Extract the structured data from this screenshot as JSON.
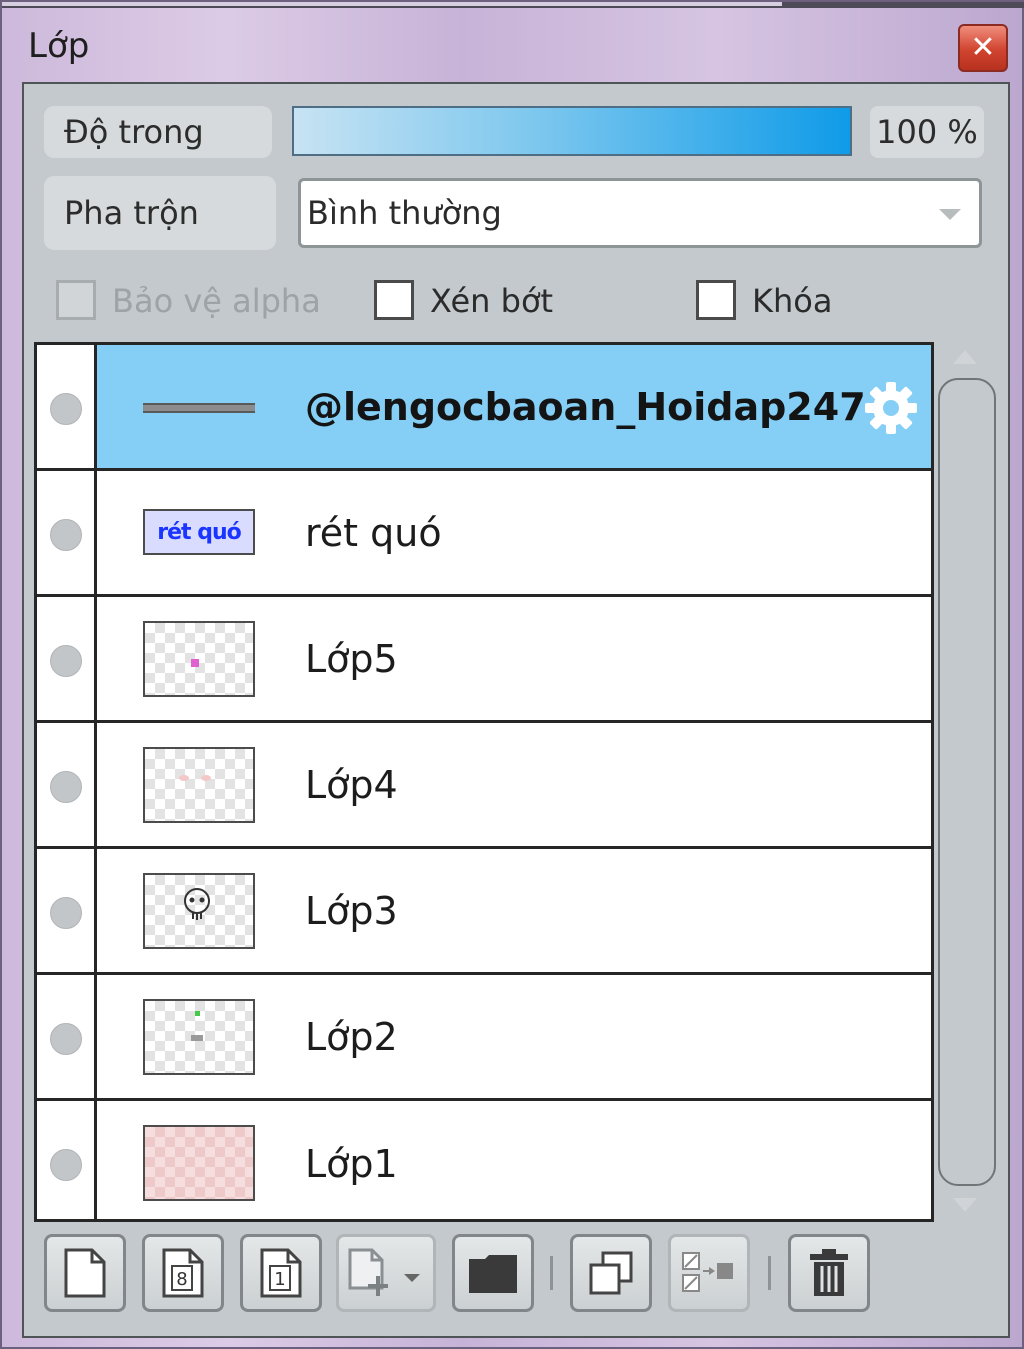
{
  "window": {
    "title": "Lớp",
    "close_icon": "close-icon"
  },
  "opacity": {
    "label": "Độ trong",
    "value_text": "100 %",
    "value": 100
  },
  "blend": {
    "label": "Pha trộn",
    "selected": "Bình thường"
  },
  "options": {
    "protect_alpha": {
      "label": "Bảo vệ alpha",
      "checked": false,
      "enabled": false
    },
    "clip": {
      "label": "Xén bớt",
      "checked": false,
      "enabled": true
    },
    "lock": {
      "label": "Khóa",
      "checked": false,
      "enabled": true
    }
  },
  "layers": [
    {
      "name": "@lengocbaoan_Hoidap247",
      "selected": true,
      "thumb": "line",
      "settings_icon": "gear-icon"
    },
    {
      "name": "rét quó",
      "selected": false,
      "thumb": "text",
      "thumb_text": "rét quó"
    },
    {
      "name": "Lớp5",
      "selected": false,
      "thumb": "transparent"
    },
    {
      "name": "Lớp4",
      "selected": false,
      "thumb": "transparent"
    },
    {
      "name": "Lớp3",
      "selected": false,
      "thumb": "transparent"
    },
    {
      "name": "Lớp2",
      "selected": false,
      "thumb": "transparent"
    },
    {
      "name": "Lớp1",
      "selected": false,
      "thumb": "pink"
    }
  ],
  "toolbar": [
    {
      "icon": "new-layer-icon"
    },
    {
      "icon": "new-8bit-layer-icon",
      "text": "8"
    },
    {
      "icon": "new-1bit-layer-icon",
      "text": "1"
    },
    {
      "icon": "add-layer-dropdown-icon",
      "enabled": false
    },
    {
      "icon": "folder-icon"
    },
    {
      "icon": "duplicate-layer-icon"
    },
    {
      "icon": "merge-down-icon",
      "enabled": false
    },
    {
      "icon": "trash-icon"
    }
  ],
  "colors": {
    "selected_row": "#85cff6",
    "opacity_bar_end": "#0f9be8",
    "close_button": "#d0442f"
  }
}
